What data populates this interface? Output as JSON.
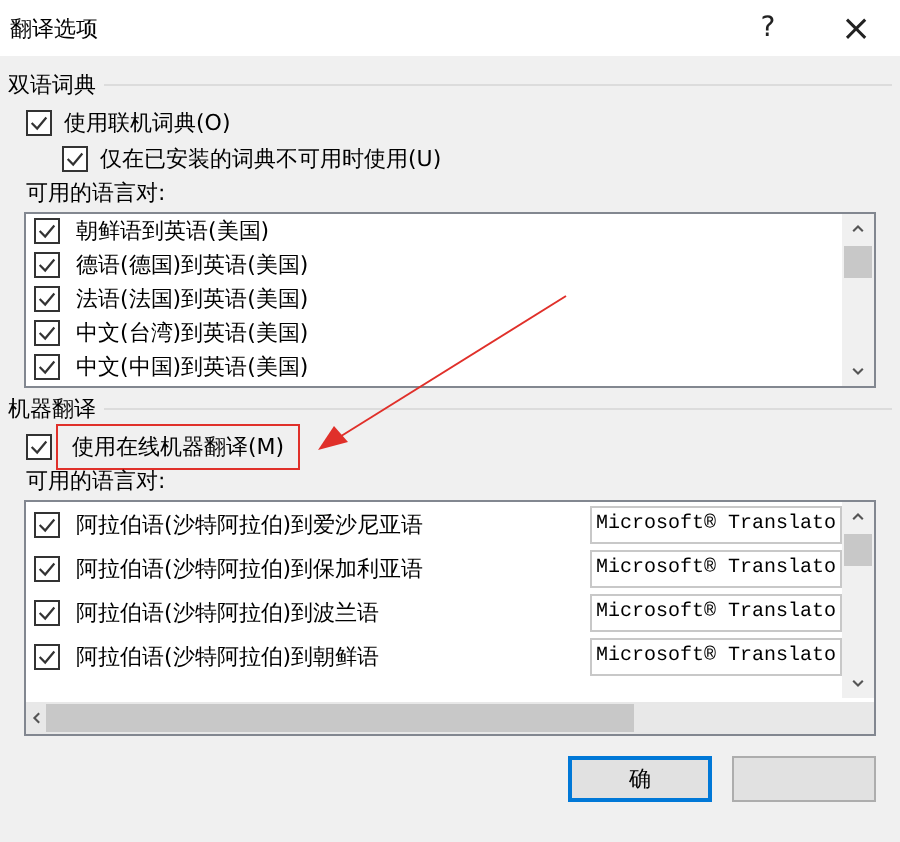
{
  "window": {
    "title": "翻译选项",
    "help": "?",
    "close": "×"
  },
  "dictionary": {
    "heading": "双语词典",
    "options": [
      {
        "label": "使用联机词典(O)",
        "checked": true,
        "indented": false
      },
      {
        "label": "仅在已安装的词典不可用时使用(U)",
        "checked": true,
        "indented": true
      }
    ],
    "pairs_label": "可用的语言对:",
    "pairs": [
      {
        "label": "朝鲜语到英语(美国)",
        "checked": true
      },
      {
        "label": "德语(德国)到英语(美国)",
        "checked": true
      },
      {
        "label": "法语(法国)到英语(美国)",
        "checked": true
      },
      {
        "label": "中文(台湾)到英语(美国)",
        "checked": true
      },
      {
        "label": "中文(中国)到英语(美国)",
        "checked": true
      }
    ]
  },
  "machine": {
    "heading": "机器翻译",
    "option": {
      "label": "使用在线机器翻译(M)",
      "checked": true,
      "highlighted": true
    },
    "pairs_label": "可用的语言对:",
    "pairs": [
      {
        "label": "阿拉伯语(沙特阿拉伯)到爱沙尼亚语",
        "checked": true,
        "service": "Microsoft® Translato"
      },
      {
        "label": "阿拉伯语(沙特阿拉伯)到保加利亚语",
        "checked": true,
        "service": "Microsoft® Translato"
      },
      {
        "label": "阿拉伯语(沙特阿拉伯)到波兰语",
        "checked": true,
        "service": "Microsoft® Translato"
      },
      {
        "label": "阿拉伯语(沙特阿拉伯)到朝鲜语",
        "checked": true,
        "service": "Microsoft® Translato"
      }
    ]
  },
  "buttons": [
    {
      "label": "确",
      "default": true
    },
    {
      "default": false
    }
  ]
}
